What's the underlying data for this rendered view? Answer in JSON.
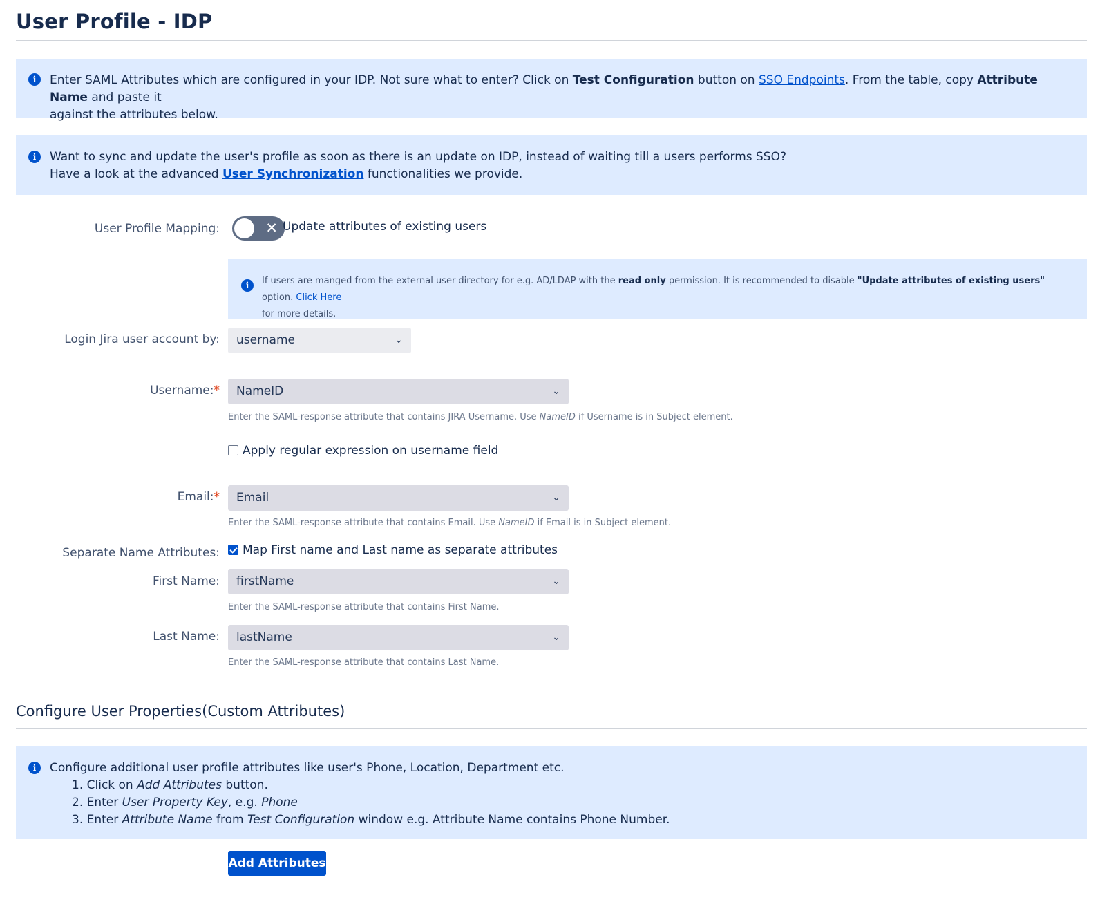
{
  "page_title": "User Profile - IDP",
  "info1": {
    "t1": "Enter SAML Attributes which are configured in your IDP. Not sure what to enter? Click on ",
    "b1": "Test Configuration",
    "t2": " button on ",
    "link": "SSO Endpoints",
    "t3": ". From the table, copy ",
    "b2": "Attribute Name",
    "t4": " and paste it",
    "line2": "against the attributes below."
  },
  "info2": {
    "line1": "Want to sync and update the user's profile as soon as there is an update on IDP, instead of waiting till a users performs SSO?",
    "t1": "Have a look at the advanced ",
    "link": "User Synchronization",
    "t2": " functionalities we provide."
  },
  "user_profile_mapping": {
    "label": "User Profile Mapping:",
    "toggle_text": "Update attributes of existing users",
    "toggle_symbol": "✕",
    "toggle_on": false
  },
  "info3": {
    "t1": "If users are manged from the external user directory for e.g. AD/LDAP with the ",
    "b1": "read only",
    "t2": " permission. It is recommended to disable ",
    "b2": "\"Update attributes of existing users\"",
    "t3": " option. ",
    "link": "Click Here",
    "line2": "for more details."
  },
  "login_by": {
    "label": "Login Jira user account by:",
    "value": "username"
  },
  "username": {
    "label": "Username:",
    "required": "*",
    "value": "NameID",
    "help_t1": "Enter the SAML-response attribute that contains JIRA Username. Use ",
    "help_i": "NameID",
    "help_t2": " if Username is in Subject element.",
    "regex_label": "Apply regular expression on username field"
  },
  "email": {
    "label": "Email:",
    "required": "*",
    "value": "Email",
    "help_t1": "Enter the SAML-response attribute that contains Email. Use ",
    "help_i": "NameID",
    "help_t2": " if Email is in Subject element."
  },
  "separate_names": {
    "label": "Separate Name Attributes:",
    "checkbox_label": "Map First name and Last name as separate attributes",
    "checked": true
  },
  "first_name": {
    "label": "First Name:",
    "value": "firstName",
    "help": "Enter the SAML-response attribute that contains First Name."
  },
  "last_name": {
    "label": "Last Name:",
    "value": "lastName",
    "help": "Enter the SAML-response attribute that contains Last Name."
  },
  "custom_section_title": "Configure User Properties(Custom Attributes)",
  "info4": {
    "line1": "Configure additional user profile attributes like user's Phone, Location, Department etc.",
    "s1_t1": "1. Click on ",
    "s1_i": "Add Attributes",
    "s1_t2": " button.",
    "s2_t1": "2. Enter ",
    "s2_i1": "User Property Key",
    "s2_t2": ", e.g. ",
    "s2_i2": "Phone",
    "s3_t1": "3. Enter ",
    "s3_i1": "Attribute Name",
    "s3_t2": " from ",
    "s3_i2": "Test Configuration",
    "s3_t3": " window e.g. Attribute Name contains Phone Number."
  },
  "add_button": "Add Attributes",
  "icons": {
    "info": "i",
    "chevron": "⌄"
  }
}
